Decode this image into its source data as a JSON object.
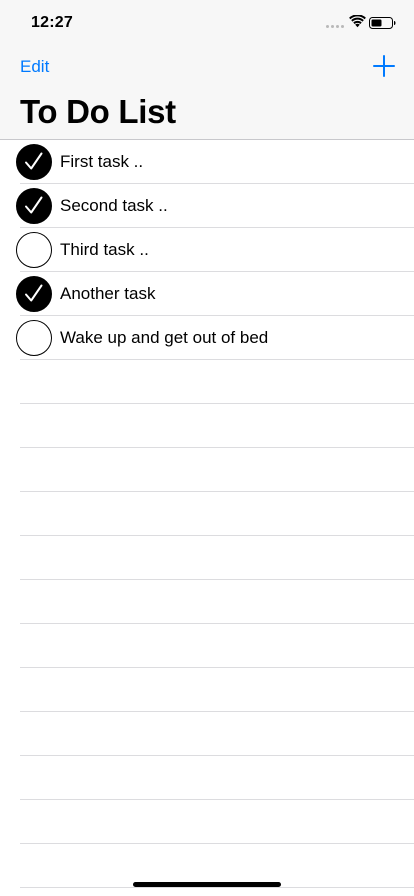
{
  "status_bar": {
    "time": "12:27",
    "icons": [
      "cellular-signal-icon",
      "wifi-icon",
      "battery-icon"
    ]
  },
  "nav_bar": {
    "edit_label": "Edit",
    "add_icon": "plus-icon",
    "title": "To Do List"
  },
  "tasks": [
    {
      "label": "First task ..",
      "done": true
    },
    {
      "label": "Second task ..",
      "done": true
    },
    {
      "label": "Third task ..",
      "done": false
    },
    {
      "label": "Another task",
      "done": true
    },
    {
      "label": "Wake up and get out of bed",
      "done": false
    }
  ],
  "colors": {
    "accent": "#007aff",
    "header_bg": "#f7f7f7",
    "separator": "#dcdcdf",
    "check_fill": "#000000"
  }
}
